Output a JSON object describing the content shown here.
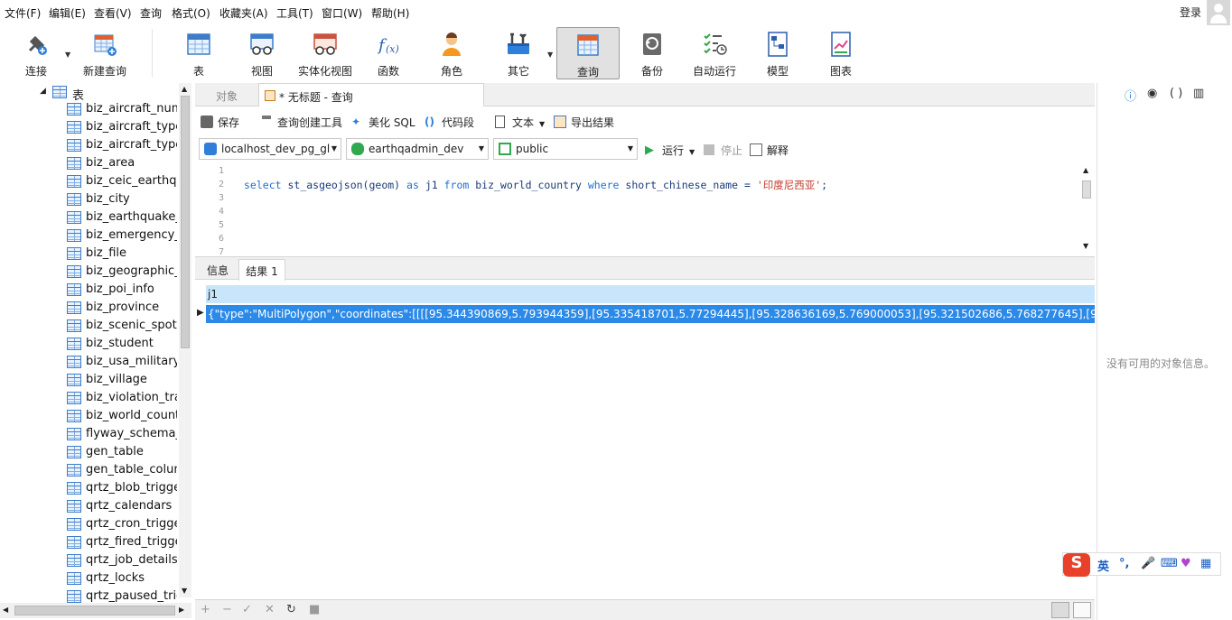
{
  "menubar": {
    "items": [
      "文件(F)",
      "编辑(E)",
      "查看(V)",
      "查询",
      "格式(O)",
      "收藏夹(A)",
      "工具(T)",
      "窗口(W)",
      "帮助(H)"
    ],
    "login": "登录"
  },
  "toolbar": {
    "connect": "连接",
    "new_query": "新建查询",
    "table": "表",
    "view": "视图",
    "materialized_view": "实体化视图",
    "function": "函数",
    "role": "角色",
    "other": "其它",
    "query": "查询",
    "backup": "备份",
    "auto_run": "自动运行",
    "model": "模型",
    "chart": "图表"
  },
  "tree": {
    "root": "表",
    "items": [
      "biz_aircraft_numb",
      "biz_aircraft_type",
      "biz_aircraft_type_r",
      "biz_area",
      "biz_ceic_earthqua",
      "biz_city",
      "biz_earthquake_ir",
      "biz_emergency_cc",
      "biz_file",
      "biz_geographic_n",
      "biz_poi_info",
      "biz_province",
      "biz_scenic_spot",
      "biz_student",
      "biz_usa_military_b",
      "biz_village",
      "biz_violation_train",
      "biz_world_country",
      "flyway_schema_his",
      "gen_table",
      "gen_table_column",
      "qrtz_blob_trigger",
      "qrtz_calendars",
      "qrtz_cron_triggers",
      "qrtz_fired_trigger",
      "qrtz_job_details",
      "qrtz_locks",
      "qrtz_paused_trigg"
    ]
  },
  "tabs": {
    "objects": "对象",
    "query_tab": "* 无标题 - 查询"
  },
  "editor_toolbar": {
    "save": "保存",
    "query_builder": "查询创建工具",
    "beautify": "美化 SQL",
    "snippet": "代码段",
    "text": "文本",
    "export": "导出结果"
  },
  "selectors": {
    "connection": "localhost_dev_pg_gl",
    "database": "earthqadmin_dev",
    "schema": "public",
    "run": "运行",
    "stop": "停止",
    "explain": "解释"
  },
  "editor": {
    "line_numbers": [
      "1",
      "2",
      "3",
      "4",
      "5",
      "6",
      "7"
    ],
    "code": {
      "k1": "select",
      "p1": " st_asgeojson(geom) ",
      "k2": "as",
      "p2": " j1 ",
      "k3": "from",
      "p3": " biz_world_country ",
      "k4": "where",
      "p4": " short_chinese_name = ",
      "s1": "'印度尼西亚'",
      "p5": ";"
    }
  },
  "results": {
    "tab_info": "信息",
    "tab_result": "结果 1",
    "column": "j1",
    "row_value": "{\"type\":\"MultiPolygon\",\"coordinates\":[[[[95.344390869,5.793944359],[95.335418701,5.77294445],[95.328636169,5.769000053],[95.321502686,5.768277645],[95.308525085,5."
  },
  "right_panel": {
    "no_info": "没有可用的对象信息。"
  },
  "ime": {
    "logo": "S",
    "lang": "英"
  },
  "colors": {
    "selected_row": "#2b8ae8",
    "header_row": "#c7e6fb",
    "keyword": "#1f6fd1",
    "string": "#c0392b"
  }
}
